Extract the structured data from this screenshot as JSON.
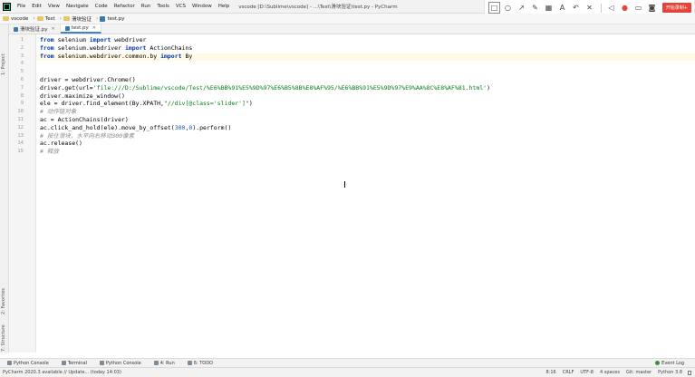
{
  "app": {
    "menu": [
      "File",
      "Edit",
      "View",
      "Navigate",
      "Code",
      "Refactor",
      "Run",
      "Tools",
      "VCS",
      "Window",
      "Help"
    ],
    "window_title": "vscode [D:\\Sublime\\vscode] - ...\\Test\\滑块验证\\test.py - PyCharm"
  },
  "snap_toolbar": {
    "tools": [
      "rectangle-icon",
      "circle-icon",
      "arrow-icon",
      "pen-icon",
      "mosaic-icon",
      "text-icon",
      "undo-icon",
      "delete-icon"
    ],
    "extra": [
      "speaker-icon",
      "mic-icon",
      "screen-icon",
      "camera-icon"
    ],
    "done_label": "开始录制+"
  },
  "breadcrumb": [
    "vscode",
    "Test",
    "滑块验证",
    "test.py"
  ],
  "tabs": [
    {
      "label": "滑块验证.py",
      "active": false
    },
    {
      "label": "test.py",
      "active": true
    }
  ],
  "left_strip": [
    "1: Project",
    "2: Favorites",
    "7: Structure"
  ],
  "code_lines": [
    {
      "n": "1",
      "html": "<span class='kw'>from</span> selenium <span class='kw'>import</span> webdriver"
    },
    {
      "n": "2",
      "html": "<span class='kw'>from</span> selenium.webdriver <span class='kw'>import</span> ActionChains"
    },
    {
      "n": "3",
      "html": "<span class='kw'>from</span> selenium.webdriver.common.by <span class='kw'>import</span> By"
    },
    {
      "n": "4",
      "html": ""
    },
    {
      "n": "5",
      "html": ""
    },
    {
      "n": "6",
      "html": "driver = webdriver.Chrome()"
    },
    {
      "n": "7",
      "html": "driver.get(url=<span class='str'>'file:///D:/Sublime/vscode/Test/%E6%BB%91%E5%9D%97%E6%B5%8B%E8%AF%95/%E6%BB%91%E5%9D%97%E9%AA%8C%E8%AF%81.html'</span>)"
    },
    {
      "n": "8",
      "html": "driver.maximize_window()"
    },
    {
      "n": "9",
      "html": "ele = driver.find_element(By.XPATH,<span class='str'>\"//div[@class='slider']\"</span>)"
    },
    {
      "n": "10",
      "html": "<span class='cmt'># 动作链对象</span>"
    },
    {
      "n": "11",
      "html": "ac = ActionChains(driver)"
    },
    {
      "n": "12",
      "html": "ac.click_and_hold(ele).move_by_offset(<span class='num'>300</span>,<span class='num'>0</span>).perform()"
    },
    {
      "n": "13",
      "html": "<span class='cmt'># 按住滑块，水平向右移动300像素</span>"
    },
    {
      "n": "14",
      "html": "ac.release()"
    },
    {
      "n": "15",
      "html": "<span class='cmt'># 释放</span>"
    }
  ],
  "bottom_tabs": [
    {
      "label": "Python Console",
      "icon": "console-icon"
    },
    {
      "label": "Terminal",
      "icon": "terminal-icon"
    },
    {
      "label": "Python Console",
      "icon": "console-icon"
    },
    {
      "label": "4: Run",
      "icon": "run-icon"
    },
    {
      "label": "6: TODO",
      "icon": "todo-icon"
    }
  ],
  "event_log": "Event Log",
  "status": {
    "message": "PyCharm 2020.3 available // Update... (today 14:03)",
    "position": "8:16",
    "line_sep": "CRLF",
    "encoding": "UTF-8",
    "indent": "4 spaces",
    "vcs": "Git: master",
    "interpreter": "Python 3.8"
  }
}
